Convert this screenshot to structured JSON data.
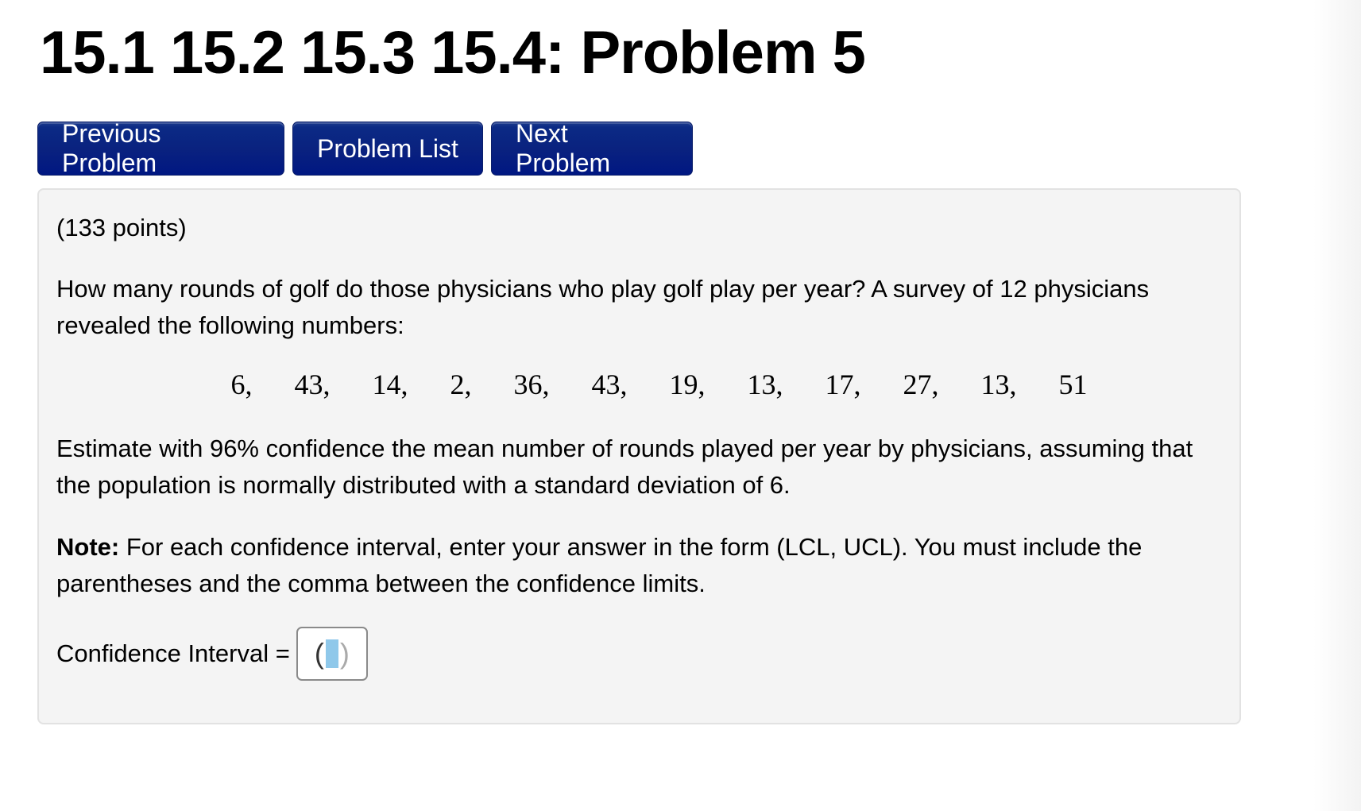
{
  "header": {
    "title": "15.1 15.2 15.3 15.4: Problem 5"
  },
  "nav": {
    "previous_label": "Previous Problem",
    "list_label": "Problem List",
    "next_label": "Next Problem",
    "button_color": "#0a227f"
  },
  "problem": {
    "points": "(133 points)",
    "question": "How many rounds of golf do those physicians who play golf play per year? A survey of 12 physicians revealed the following numbers:",
    "numbers": [
      "6,",
      "43,",
      "14,",
      "2,",
      "36,",
      "43,",
      "19,",
      "13,",
      "17,",
      "27,",
      "13,",
      "51"
    ],
    "instruction": "Estimate with 96% confidence the mean number of rounds played per year by physicians, assuming that the population is normally distributed with a standard deviation of 6.",
    "note_label": "Note:",
    "note_text": " For each confidence interval, enter your answer in the form (LCL, UCL). You must include the parentheses and the comma between the confidence limits.",
    "answer_label": "Confidence Interval =",
    "answer_open_paren": "(",
    "answer_close_paren": ")",
    "answer_value": ""
  }
}
